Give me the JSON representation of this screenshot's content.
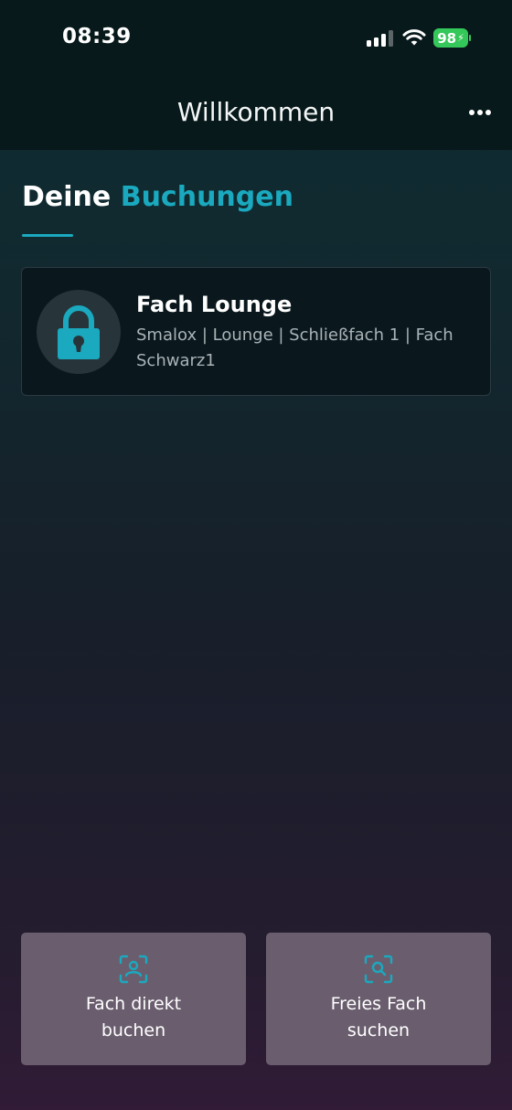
{
  "status_bar": {
    "time": "08:39",
    "battery": "98"
  },
  "nav": {
    "title": "Willkommen",
    "more_icon": "ellipsis-icon"
  },
  "section": {
    "title_prefix": "Deine",
    "title_accent": "Buchungen",
    "accent_color": "#1aa9be"
  },
  "bookings": [
    {
      "icon": "lock-icon",
      "title": "Fach Lounge",
      "subtitle": "Smalox | Lounge | Schließfach 1 | Fach Schwarz1"
    }
  ],
  "actions": {
    "book_direct": {
      "icon": "scan-user-icon",
      "label": "Fach direkt buchen"
    },
    "search_free": {
      "icon": "scan-search-icon",
      "label": "Freies Fach suchen"
    }
  },
  "colors": {
    "header_bg": "#07191b",
    "card_bg": "#0a181d",
    "button_bg": "#6a5e6e",
    "battery": "#34c759"
  }
}
